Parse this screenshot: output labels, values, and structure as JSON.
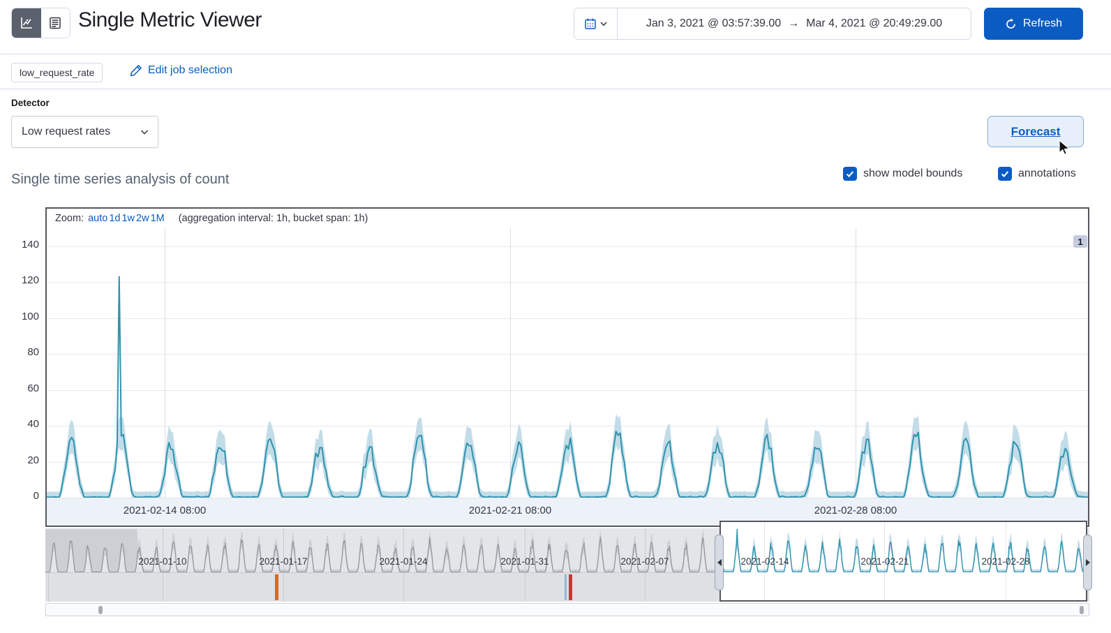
{
  "header": {
    "title": "Single Metric Viewer",
    "view_toggle": [
      "chart-view",
      "table-view"
    ],
    "time_range": {
      "start": "Jan 3, 2021 @ 03:57:39.00",
      "arrow": "→",
      "end": "Mar 4, 2021 @ 20:49:29.00"
    },
    "refresh_label": "Refresh"
  },
  "job_bar": {
    "job_badge": "low_request_rate",
    "edit_link": "Edit job selection"
  },
  "detector": {
    "label": "Detector",
    "selected": "Low request rates"
  },
  "forecast_label": "Forecast",
  "section": {
    "heading": "Single time series analysis of count",
    "checkboxes": [
      {
        "label": "show model bounds",
        "checked": true
      },
      {
        "label": "annotations",
        "checked": true
      }
    ]
  },
  "chart_toolbar": {
    "zoom_label": "Zoom:",
    "zoom_options": [
      "auto",
      "1d",
      "1w",
      "2w",
      "1M"
    ],
    "aggregation_note": "(aggregation interval: 1h, bucket span: 1h)"
  },
  "annotation_badge": "1",
  "colors": {
    "accent_blue": "#0a5cc2",
    "link_blue": "#0a5dc2",
    "series_teal": "#2f93ad",
    "bounds_band": "#c3dde8",
    "context_line": "#96989d",
    "context_band": "#cdcfd4",
    "marker_orange": "#e5660f",
    "marker_red": "#da2f36",
    "marker_lightblue": "#8fb8da",
    "chart_border": "#54575e"
  },
  "chart_data": {
    "main_chart": {
      "type": "line",
      "series_name": "count",
      "bucket_span": "1h",
      "aggregation_interval": "1h",
      "days": 21,
      "start": "2021-02-12 01:00",
      "daily_peaks": [
        31,
        35,
        28,
        30,
        33,
        29,
        27,
        34,
        30,
        28,
        32,
        35,
        29,
        31,
        33,
        28,
        30,
        34,
        29,
        31,
        27
      ],
      "anomaly": {
        "index": 35,
        "value": 123,
        "time": "2021-02-13 12:00"
      },
      "ylim": [
        0,
        150
      ],
      "yticks": [
        0,
        20,
        40,
        60,
        80,
        100,
        120,
        140
      ],
      "xticks": [
        {
          "label": "2021-02-14 08:00",
          "frac": 0.113
        },
        {
          "label": "2021-02-21 08:00",
          "frac": 0.445
        },
        {
          "label": "2021-02-28 08:00",
          "frac": 0.777
        }
      ],
      "model_bounds_shown": true,
      "annotations_shown": true
    },
    "context_chart": {
      "type": "line",
      "days": 61,
      "start": "2021-01-03",
      "ylim": [
        0,
        50
      ],
      "clip": 49,
      "wide_bounds_until_day": 5.4,
      "daily_peaks": [
        31,
        35,
        28,
        30,
        33,
        29,
        27,
        34,
        30,
        28,
        32,
        35,
        29,
        31,
        33,
        28,
        30,
        34,
        29,
        31,
        27
      ],
      "anomaly": {
        "index": 972,
        "value": 123
      },
      "xticks": [
        {
          "label": "2021-01-10",
          "frac": 0.112
        },
        {
          "label": "2021-01-17",
          "frac": 0.228
        },
        {
          "label": "2021-01-24",
          "frac": 0.343
        },
        {
          "label": "2021-01-31",
          "frac": 0.459
        },
        {
          "label": "2021-02-07",
          "frac": 0.574
        },
        {
          "label": "2021-02-14",
          "frac": 0.689
        },
        {
          "label": "2021-02-21",
          "frac": 0.804
        },
        {
          "label": "2021-02-28",
          "frac": 0.92
        }
      ],
      "selection": {
        "start_frac": 0.646,
        "end_frac": 0.998
      },
      "swimlane_markers": [
        {
          "kind": "anomaly",
          "color": "marker_orange",
          "frac": 0.22,
          "width": 5
        },
        {
          "kind": "annotation",
          "color": "marker_lightblue",
          "frac": 0.4975,
          "width": 3
        },
        {
          "kind": "anomaly",
          "color": "marker_red",
          "frac": 0.5015,
          "width": 5
        }
      ]
    }
  }
}
